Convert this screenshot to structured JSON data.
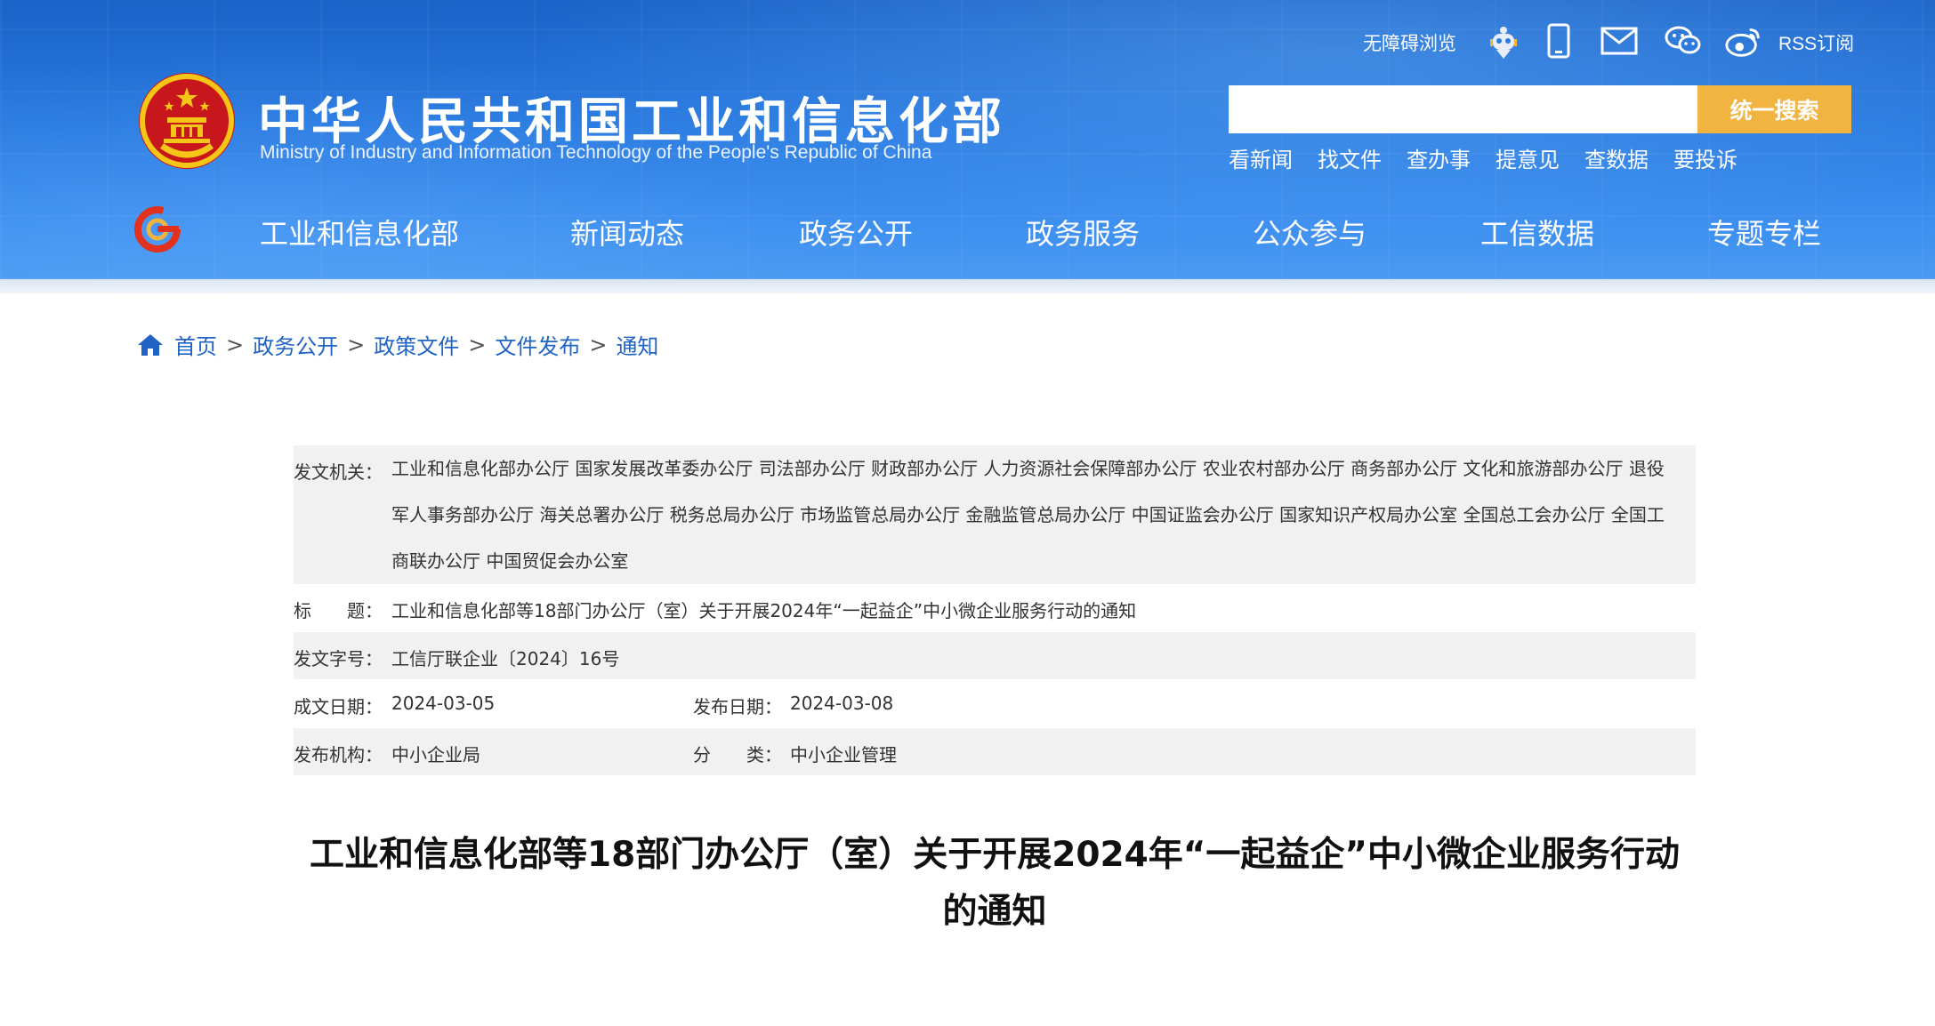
{
  "header": {
    "title": "中华人民共和国工业和信息化部",
    "subtitle": "Ministry of Industry and Information Technology of the People's Republic of China",
    "accessibility_label": "无障碍浏览",
    "rss_label": "RSS订阅",
    "icons": [
      "robot-icon",
      "mobile-icon",
      "mail-icon",
      "wechat-icon",
      "weibo-icon"
    ],
    "search": {
      "placeholder": "",
      "value": "",
      "button_label": "统一搜索"
    },
    "quick_links": [
      "看新闻",
      "找文件",
      "查办事",
      "提意见",
      "查数据",
      "要投诉"
    ],
    "nav": [
      "工业和信息化部",
      "新闻动态",
      "政务公开",
      "政务服务",
      "公众参与",
      "工信数据",
      "专题专栏"
    ]
  },
  "colors": {
    "header_blue": "#2a7ae0",
    "search_button": "#f2b441",
    "link_blue": "#1f64c4",
    "row_shade": "#f1f1f1"
  },
  "breadcrumb": [
    "首页",
    "政务公开",
    "政策文件",
    "文件发布",
    "通知"
  ],
  "breadcrumb_separator": ">",
  "info": {
    "issuer_label": "发文机关：",
    "issuer_value": "工业和信息化部办公厅 国家发展改革委办公厅 司法部办公厅 财政部办公厅 人力资源社会保障部办公厅 农业农村部办公厅 商务部办公厅 文化和旅游部办公厅 退役军人事务部办公厅 海关总署办公厅 税务总局办公厅 市场监管总局办公厅 金融监管总局办公厅 中国证监会办公厅 国家知识产权局办公室 全国总工会办公厅 全国工商联办公厅 中国贸促会办公室",
    "title_label": "标　　题：",
    "title_value": "工业和信息化部等18部门办公厅（室）关于开展2024年“一起益企”中小微企业服务行动的通知",
    "docno_label": "发文字号：",
    "docno_value": "工信厅联企业〔2024〕16号",
    "written_date_label": "成文日期：",
    "written_date_value": "2024-03-05",
    "publish_date_label": "发布日期：",
    "publish_date_value": "2024-03-08",
    "org_label": "发布机构：",
    "org_value": "中小企业局",
    "category_label": "分　　类：",
    "category_value": "中小企业管理"
  },
  "article": {
    "title": "工业和信息化部等18部门办公厅（室）关于开展2024年“一起益企”中小微企业服务行动的通知"
  }
}
